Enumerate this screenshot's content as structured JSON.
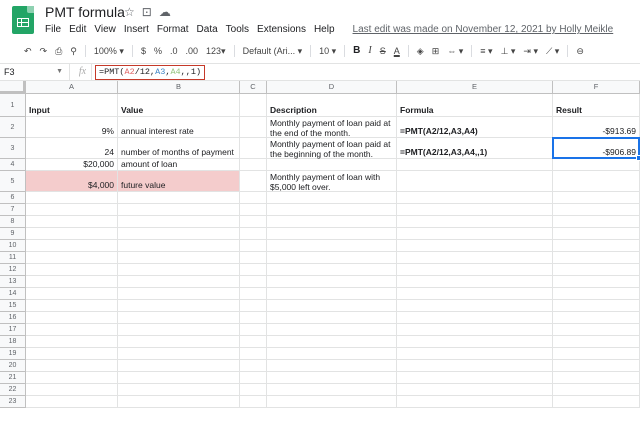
{
  "app": {
    "title": "PMT formula",
    "menu": [
      "File",
      "Edit",
      "View",
      "Insert",
      "Format",
      "Data",
      "Tools",
      "Extensions",
      "Help"
    ],
    "last_edit": "Last edit was made on November 12, 2021 by Holly Meikle"
  },
  "toolbar": {
    "zoom": "100%",
    "currency": "$",
    "percent": "%",
    "dec_less": ".0",
    "dec_more": ".00",
    "more_formats": "123",
    "font": "Default (Ari...",
    "font_size": "10",
    "bold": "B",
    "italic": "I",
    "strike": "S",
    "text_color": "A"
  },
  "formula_bar": {
    "cell_ref": "F3",
    "fx": "fx",
    "formula_prefix": "=PMT(",
    "ref1": "A2",
    "mid1": "/12,",
    "ref2": "A3",
    "mid2": ",",
    "ref3": "A4",
    "formula_suffix": ",,1)"
  },
  "columns": [
    "A",
    "B",
    "C",
    "D",
    "E",
    "F"
  ],
  "rows": [
    "1",
    "2",
    "3",
    "4",
    "5",
    "6",
    "7",
    "8",
    "9",
    "10",
    "11",
    "12",
    "13",
    "14",
    "15",
    "16",
    "17",
    "18",
    "19",
    "20",
    "21",
    "22",
    "23"
  ],
  "cells": {
    "A1": "Input",
    "B1": "Value",
    "D1": "Description",
    "E1": "Formula",
    "F1": "Result",
    "A2": "9%",
    "B2": "annual interest rate",
    "D2": "Monthly payment of loan paid at the end of the month.",
    "E2": "=PMT(A2/12,A3,A4)",
    "F2": "-$913.69",
    "A3": "24",
    "B3": "number of months of payment",
    "D3": "Monthly payment of loan paid at the beginning of the month.",
    "E3": "=PMT(A2/12,A3,A4,,1)",
    "F3": "-$906.89",
    "A4": "$20,000",
    "B4": "amount of loan",
    "A5": "$4,000",
    "B5": "future value",
    "D5": "Monthly payment of loan with $5,000 left over."
  },
  "colors": {
    "highlight": "#f4cccc",
    "selection": "#1a73e8",
    "sheets_green": "#23a566"
  }
}
